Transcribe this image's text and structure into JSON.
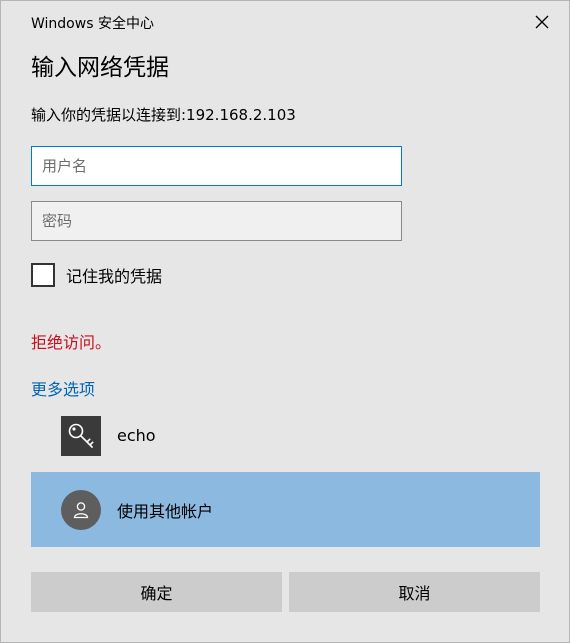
{
  "window": {
    "title": "Windows 安全中心"
  },
  "dialog": {
    "heading": "输入网络凭据",
    "prompt": "输入你的凭据以连接到:192.168.2.103"
  },
  "fields": {
    "username": {
      "value": "",
      "placeholder": "用户名"
    },
    "password": {
      "value": "",
      "placeholder": "密码"
    }
  },
  "remember": {
    "label": "记住我的凭据",
    "checked": false
  },
  "error": {
    "text": "拒绝访问。",
    "color": "#c50f1f"
  },
  "more_options": {
    "label": "更多选项",
    "color": "#0066b4"
  },
  "accounts": [
    {
      "label": "echo",
      "icon": "key-icon",
      "selected": false
    },
    {
      "label": "使用其他帐户",
      "icon": "user-icon",
      "selected": true
    }
  ],
  "buttons": {
    "ok": "确定",
    "cancel": "取消"
  },
  "colors": {
    "accent": "#0078d7",
    "selection": "#8cb9e0"
  }
}
